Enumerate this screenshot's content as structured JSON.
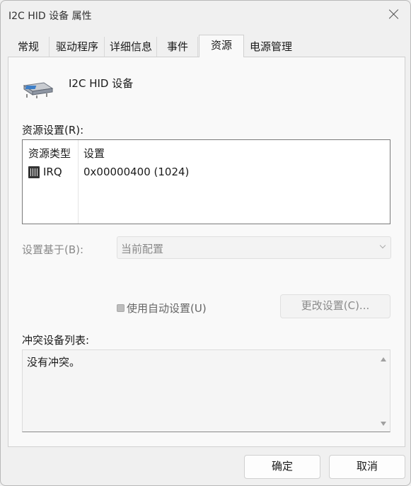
{
  "window": {
    "title": "I2C HID 设备 属性"
  },
  "tabs": [
    {
      "label": "常规"
    },
    {
      "label": "驱动程序"
    },
    {
      "label": "详细信息"
    },
    {
      "label": "事件"
    },
    {
      "label": "资源",
      "active": true
    },
    {
      "label": "电源管理"
    }
  ],
  "device": {
    "name": "I2C HID 设备",
    "icon": "hid-device-icon"
  },
  "resources": {
    "label": "资源设置(R):",
    "columns": [
      "资源类型",
      "设置"
    ],
    "rows": [
      {
        "type": "IRQ",
        "setting": "0x00000400 (1024)",
        "icon": "irq-chip-icon"
      }
    ]
  },
  "settings_based_on": {
    "label": "设置基于(B):",
    "value": "当前配置"
  },
  "auto_settings": {
    "label": "使用自动设置(U)",
    "checked": true
  },
  "change_settings_label": "更改设置(C)...",
  "conflict": {
    "label": "冲突设备列表:",
    "text": "没有冲突。"
  },
  "footer": {
    "ok": "确定",
    "cancel": "取消"
  }
}
